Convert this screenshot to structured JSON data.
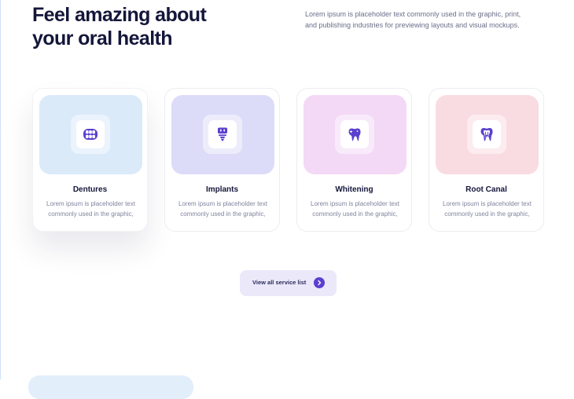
{
  "hero": {
    "title_line1": "Feel amazing about",
    "title_line2": "your oral health",
    "description": "Lorem ipsum is placeholder text commonly used in the graphic, print, and publishing industries for previewing layouts and visual mockups."
  },
  "services": [
    {
      "title": "Dentures",
      "description": "Lorem ipsum is placeholder text commonly used in the graphic,",
      "icon": "dentures-icon",
      "tile_color": "#dbeaf9"
    },
    {
      "title": "Implants",
      "description": "Lorem ipsum is placeholder text commonly used in the graphic,",
      "icon": "implant-icon",
      "tile_color": "#dcdcf8"
    },
    {
      "title": "Whitening",
      "description": "Lorem ipsum is placeholder text commonly used in the graphic,",
      "icon": "tooth-sparkle-icon",
      "tile_color": "#f3d9f6"
    },
    {
      "title": "Root Canal",
      "description": "Lorem ipsum is placeholder text commonly used in the graphic,",
      "icon": "root-canal-icon",
      "tile_color": "#f9dce2"
    }
  ],
  "cta": {
    "label": "View all service list",
    "icon": "chevron-right-icon"
  },
  "colors": {
    "accent": "#5b3fd0",
    "heading": "#14163a",
    "cta_background": "#ebe8fa"
  }
}
